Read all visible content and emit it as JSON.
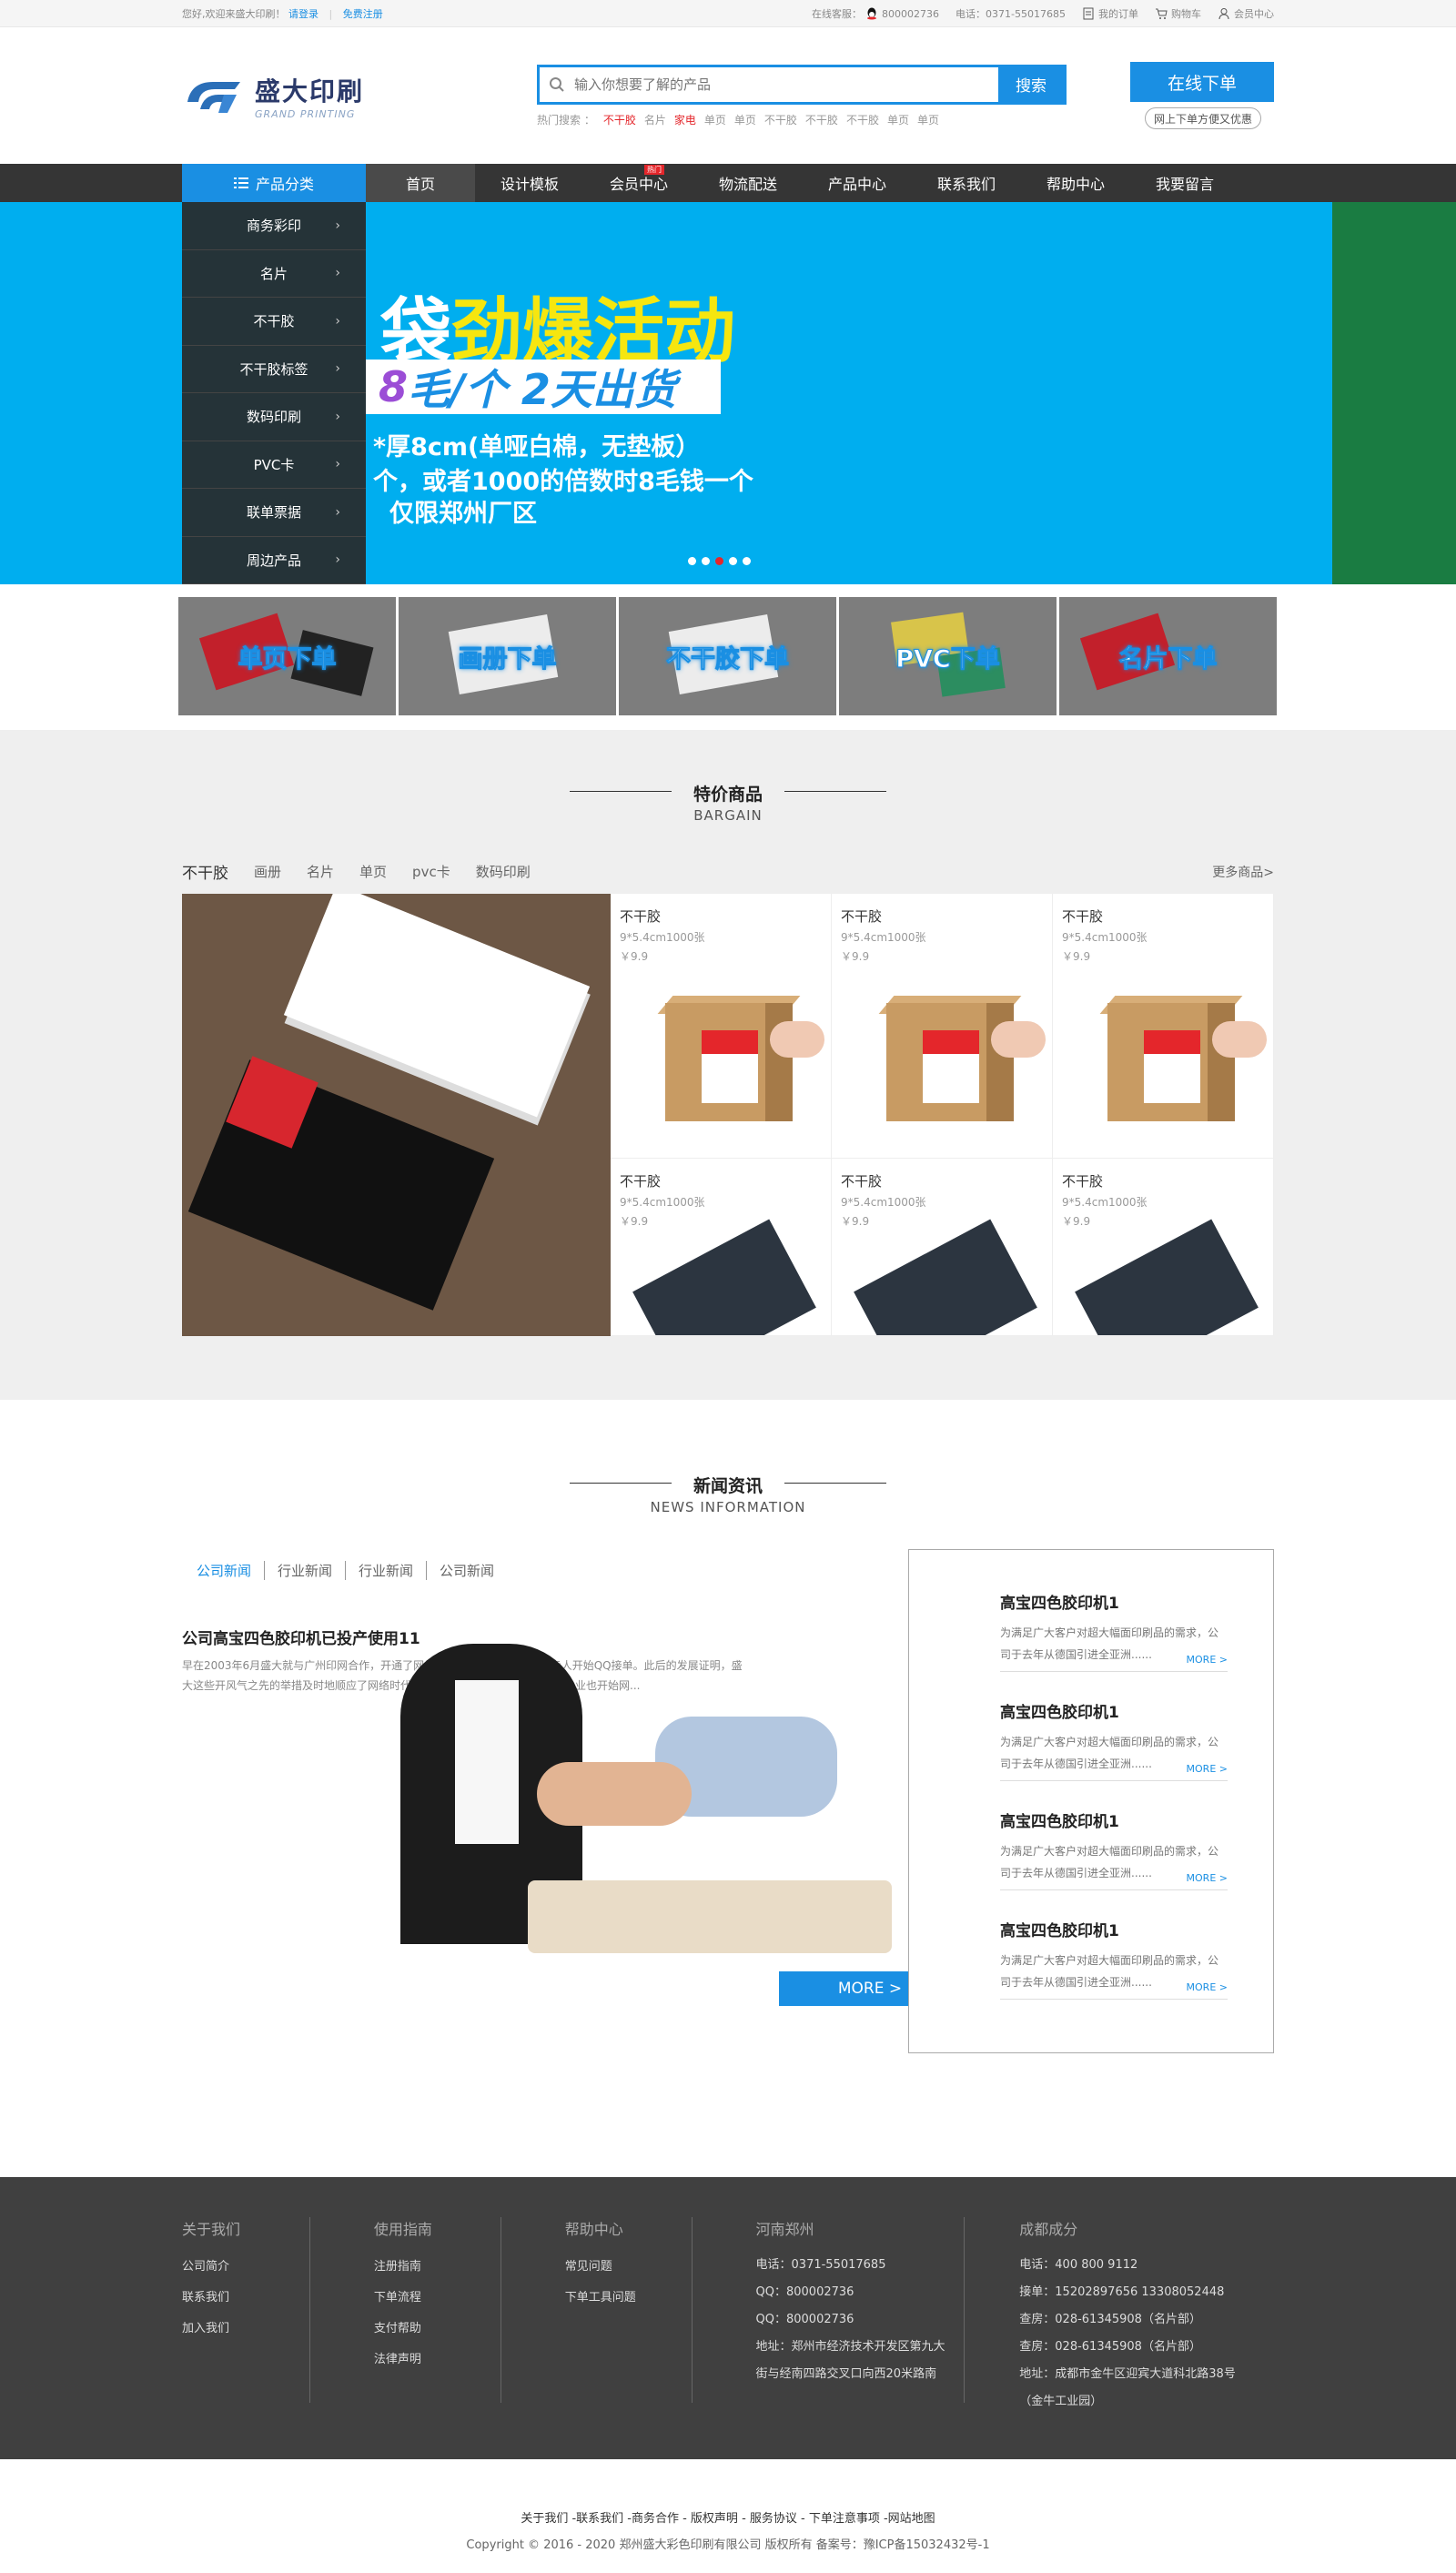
{
  "topbar": {
    "welcome": "您好,欢迎来盛大印刷！",
    "login": "请登录",
    "register": "免费注册",
    "service_label": "在线客服：",
    "qq": "800002736",
    "phone": "电话：0371-55017685",
    "my_order": "我的订单",
    "cart": "购物车",
    "member": "会员中心"
  },
  "header": {
    "logo_cn": "盛大印刷",
    "logo_en": "GRAND PRINTING",
    "search_placeholder": "输入你想要了解的产品",
    "search_button": "搜索",
    "hot_label": "热门搜索 ：",
    "hot_items": [
      "不干胶",
      "名片",
      "家电",
      "单页",
      "单页",
      "不干胶",
      "不干胶",
      "不干胶",
      "单页",
      "单页"
    ],
    "order_button": "在线下单",
    "order_tip": "网上下单方便又优惠"
  },
  "nav": {
    "category": "产品分类",
    "items": [
      "首页",
      "设计模板",
      "会员中心",
      "物流配送",
      "产品中心",
      "联系我们",
      "帮助中心",
      "我要留言"
    ],
    "hot_badge": "热门"
  },
  "categories": [
    "商务彩印",
    "名片",
    "不干胶",
    "不干胶标签",
    "数码印刷",
    "PVC卡",
    "联单票据",
    "周边产品"
  ],
  "banner": {
    "line1_a": "袋",
    "line1_b": "劲爆活动",
    "line2_a": "8",
    "line2_b": "毛/个  2天出货",
    "line3": "*厚8cm(单哑白棉，无垫板）",
    "line4": "个，或者1000的倍数时8毛钱一个",
    "line5": "仅限郑州厂区"
  },
  "tiles": [
    "单页下单",
    "画册下单",
    "不干胶下单",
    "PVC下单",
    "名片下单"
  ],
  "bargain": {
    "title_cn": "特价商品",
    "title_en": "BARGAIN",
    "tabs": [
      "不干胶",
      "画册",
      "名片",
      "单页",
      "pvc卡",
      "数码印刷"
    ],
    "more": "更多商品>",
    "products": [
      {
        "name": "不干胶",
        "spec": "9*5.4cm1000张",
        "price": "￥9.9"
      },
      {
        "name": "不干胶",
        "spec": "9*5.4cm1000张",
        "price": "￥9.9"
      },
      {
        "name": "不干胶",
        "spec": "9*5.4cm1000张",
        "price": "￥9.9"
      },
      {
        "name": "不干胶",
        "spec": "9*5.4cm1000张",
        "price": "￥9.9"
      },
      {
        "name": "不干胶",
        "spec": "9*5.4cm1000张",
        "price": "￥9.9"
      },
      {
        "name": "不干胶",
        "spec": "9*5.4cm1000张",
        "price": "￥9.9"
      }
    ]
  },
  "news": {
    "title_cn": "新闻资讯",
    "title_en": "NEWS INFORMATION",
    "tabs": [
      "公司新闻",
      "行业新闻",
      "行业新闻",
      "公司新闻"
    ],
    "main_more": "MORE >",
    "main_title": "公司高宝四色胶印机已投产使用11",
    "main_desc": "早在2003年6月盛大就与广州印网合作，开通了网络接单：2004年，又指派专人开始QQ接单。此后的发展证明，盛大这些开风气之先的举措及时地顺应了网络时代的发展潮流。虽然后来很多印刷企业也开始网...",
    "side_items": [
      {
        "title": "高宝四色胶印机1",
        "desc": "为满足广大客户对超大幅面印刷品的需求，公司于去年从德国引进全亚洲......",
        "more": "MORE >"
      },
      {
        "title": "高宝四色胶印机1",
        "desc": "为满足广大客户对超大幅面印刷品的需求，公司于去年从德国引进全亚洲......",
        "more": "MORE >"
      },
      {
        "title": "高宝四色胶印机1",
        "desc": "为满足广大客户对超大幅面印刷品的需求，公司于去年从德国引进全亚洲......",
        "more": "MORE >"
      },
      {
        "title": "高宝四色胶印机1",
        "desc": "为满足广大客户对超大幅面印刷品的需求，公司于去年从德国引进全亚洲......",
        "more": "MORE >"
      }
    ]
  },
  "footer": {
    "about": {
      "title": "关于我们",
      "items": [
        "公司简介",
        "联系我们",
        "加入我们"
      ]
    },
    "guide": {
      "title": "使用指南",
      "items": [
        "注册指南",
        "下单流程",
        "支付帮助",
        "法律声明"
      ]
    },
    "help": {
      "title": "帮助中心",
      "items": [
        "常见问题",
        "下单工具问题"
      ]
    },
    "zhengzhou": {
      "title": "河南郑州",
      "items": [
        "电话：0371-55017685",
        "QQ：800002736",
        "QQ：800002736",
        "地址：郑州市经济技术开发区第九大",
        "街与经南四路交叉口向西20米路南"
      ]
    },
    "chengdu": {
      "title": "成都成分",
      "items": [
        "电话：400 800 9112",
        "接单：15202897656 13308052448",
        "查房：028-61345908（名片部）",
        "查房：028-61345908（名片部）",
        "地址：成都市金牛区迎宾大道科北路38号",
        "（金牛工业园）"
      ]
    },
    "links": "关于我们 -联系我们 -商务合作 - 版权声明 - 服务协议 - 下单注意事项 -网站地图",
    "copyright": "Copyright © 2016 - 2020 郑州盛大彩色印刷有限公司 版权所有 备案号：豫ICP备15032432号-1"
  },
  "colors": {
    "accent": "#1a8fe3",
    "nav_bg": "#353535",
    "footer_bg": "#404040",
    "red": "#e4262b"
  }
}
